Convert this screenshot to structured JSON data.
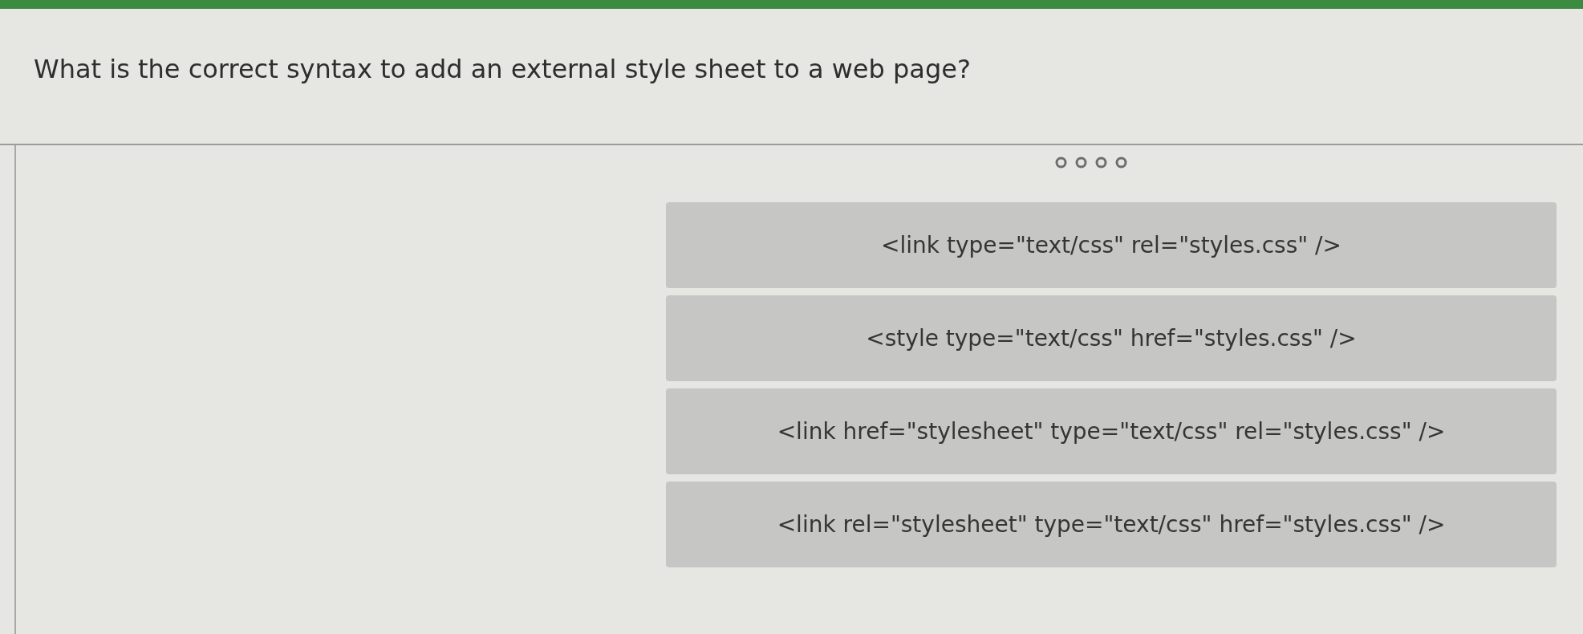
{
  "question": "What is the correct syntax to add an external style sheet to a web page?",
  "pager": [
    {
      "selected": false
    },
    {
      "selected": false
    },
    {
      "selected": false
    },
    {
      "selected": false
    }
  ],
  "options": [
    {
      "label": "<link type=\"text/css\" rel=\"styles.css\" />",
      "selected": false
    },
    {
      "label": "<style type=\"text/css\" href=\"styles.css\" />",
      "selected": false
    },
    {
      "label": "<link href=\"stylesheet\" type=\"text/css\" rel=\"styles.css\" />",
      "selected": false
    },
    {
      "label": "<link rel=\"stylesheet\" type=\"text/css\" href=\"styles.css\" />",
      "selected": false
    }
  ]
}
